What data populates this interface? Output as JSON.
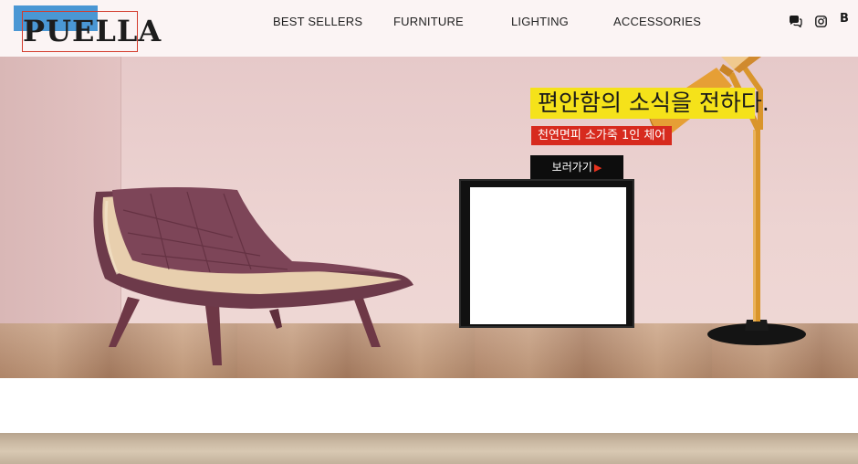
{
  "header": {
    "logo_text": "PUELLA",
    "nav": [
      "BEST SELLERS",
      "FURNITURE",
      "LIGHTING",
      "ACCESSORIES"
    ],
    "icons": [
      "chat-icon",
      "instagram-icon",
      "blog-icon"
    ],
    "blog_glyph": "B"
  },
  "hero": {
    "headline": "편안함의 소식을 전하다.",
    "subtitle": "천연면피 소가죽  1인 체어",
    "cta_label": "보러가기",
    "cta_arrow": "▶"
  },
  "colors": {
    "logo_blue": "#4a97d4",
    "logo_red": "#d33b2c",
    "highlight_yellow": "#f5e21a",
    "badge_red": "#d72a1e",
    "cta_black": "#0d0d0d"
  }
}
